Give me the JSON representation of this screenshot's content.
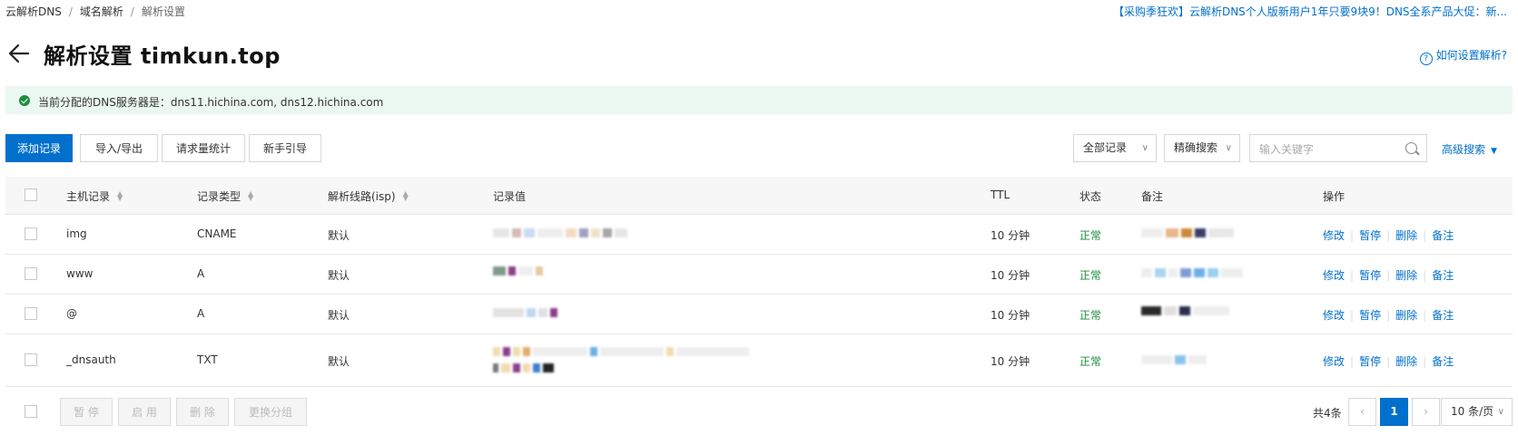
{
  "breadcrumb": {
    "items": [
      "云解析DNS",
      "域名解析",
      "解析设置"
    ],
    "separator": "/"
  },
  "promo": {
    "text": "【采购季狂欢】云解析DNS个人版新用户1年只要9块9！DNS全系产品大促：新..."
  },
  "header": {
    "title": "解析设置 timkun.top",
    "help_link": "如何设置解析?"
  },
  "alert": {
    "text": "当前分配的DNS服务器是：dns11.hichina.com, dns12.hichina.com"
  },
  "toolbar": {
    "add_record": "添加记录",
    "import_export": "导入/导出",
    "request_stats": "请求量统计",
    "beginner_guide": "新手引导",
    "filter_select": "全部记录",
    "search_mode": "精确搜索",
    "search_placeholder": "输入关键字",
    "advanced_search": "高级搜索"
  },
  "table": {
    "columns": [
      "主机记录",
      "记录类型",
      "解析线路(isp)",
      "记录值",
      "TTL",
      "状态",
      "备注",
      "操作"
    ],
    "rows": [
      {
        "host": "img",
        "type": "CNAME",
        "line": "默认",
        "ttl": "10 分钟",
        "status": "正常"
      },
      {
        "host": "www",
        "type": "A",
        "line": "默认",
        "ttl": "10 分钟",
        "status": "正常"
      },
      {
        "host": "@",
        "type": "A",
        "line": "默认",
        "ttl": "10 分钟",
        "status": "正常"
      },
      {
        "host": "_dnsauth",
        "type": "TXT",
        "line": "默认",
        "ttl": "10 分钟",
        "status": "正常"
      }
    ],
    "actions": {
      "edit": "修改",
      "pause": "暂停",
      "delete": "删除",
      "note": "备注"
    }
  },
  "footer": {
    "pause": "暂 停",
    "enable": "启 用",
    "delete": "删 除",
    "change_group": "更换分组",
    "total": "共4条",
    "current_page": "1",
    "page_size": "10 条/页"
  },
  "colors": {
    "accent": "#0070cc",
    "success": "#1e8e3e",
    "alert_bg": "#ebf8f1"
  }
}
